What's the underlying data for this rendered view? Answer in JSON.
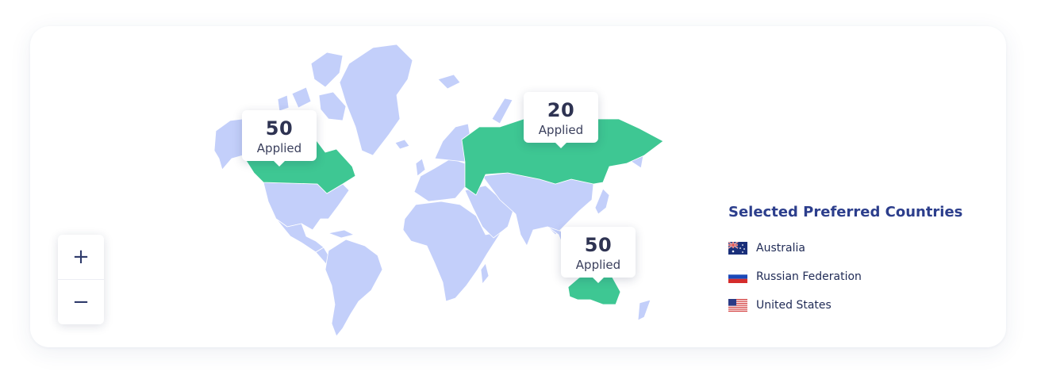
{
  "colors": {
    "land": "#c3cffa",
    "selected": "#3ec793",
    "border": "#ffffff",
    "legend_title": "#2c3e8c"
  },
  "zoom": {
    "in_label": "+",
    "out_label": "−"
  },
  "callouts": [
    {
      "country": "United States",
      "count": "50",
      "label": "Applied"
    },
    {
      "country": "Russian Federation",
      "count": "20",
      "label": "Applied"
    },
    {
      "country": "Australia",
      "count": "50",
      "label": "Applied"
    }
  ],
  "legend": {
    "title": "Selected Preferred Countries",
    "items": [
      {
        "name": "Australia",
        "flag": "au-flag"
      },
      {
        "name": "Russian Federation",
        "flag": "ru-flag"
      },
      {
        "name": "United States",
        "flag": "us-flag"
      }
    ]
  }
}
